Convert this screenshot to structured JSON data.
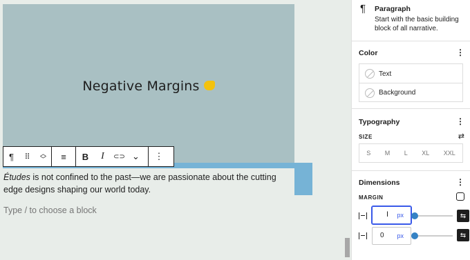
{
  "editor": {
    "cover_title": "Negative Margins",
    "paragraph_lead": "Études",
    "paragraph_rest": " is not confined to the past—we are passionate about the cutting edge designs shaping our world today.",
    "placeholder": "Type / to choose a block"
  },
  "toolbar": {
    "paragraph_icon": "¶",
    "drag_icon": "⠿",
    "move_icon": "⌃⌄",
    "align_icon": "≡",
    "bold_label": "B",
    "italic_label": "I",
    "link_icon": "⊂⊃",
    "more_icon": "⌄",
    "options_icon": "⋮"
  },
  "sidebar": {
    "block_icon": "¶",
    "block_title": "Paragraph",
    "block_description": "Start with the basic building block of all narrative.",
    "color": {
      "title": "Color",
      "items": [
        "Text",
        "Background"
      ]
    },
    "typography": {
      "title": "Typography",
      "size_label": "SIZE",
      "sizes": [
        "S",
        "M",
        "L",
        "XL",
        "XXL"
      ]
    },
    "dimensions": {
      "title": "Dimensions",
      "margin_label": "MARGIN",
      "top": {
        "value": "",
        "unit": "px"
      },
      "bottom": {
        "value": "0",
        "unit": "px"
      }
    },
    "kebab_icon": "⋮",
    "adjust_icon": "⇄",
    "custom_icon": "⇆"
  },
  "colors": {
    "accent": "#3858e9",
    "cover_bg": "#a9c0c3",
    "selection": "#76b3d6",
    "slider": "#3582c4"
  }
}
